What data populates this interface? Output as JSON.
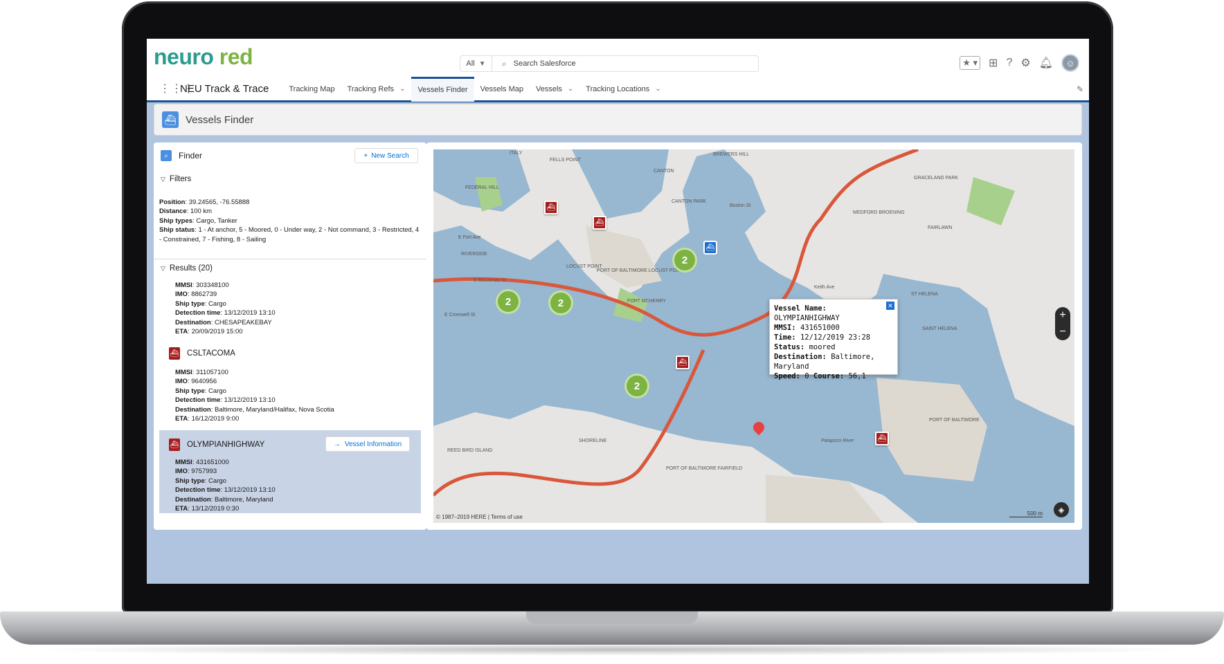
{
  "header": {
    "logo_part1": "neuro",
    "logo_part2": "red",
    "search_scope": "All",
    "search_placeholder": "Search Salesforce"
  },
  "nav": {
    "app_name": "NEU Track & Trace",
    "tabs": [
      {
        "label": "Tracking Map"
      },
      {
        "label": "Tracking Refs"
      },
      {
        "label": "Vessels Finder"
      },
      {
        "label": "Vessels Map"
      },
      {
        "label": "Vessels"
      },
      {
        "label": "Tracking Locations"
      }
    ]
  },
  "page": {
    "title": "Vessels Finder"
  },
  "finder": {
    "title": "Finder",
    "new_search_label": "New Search",
    "filters_title": "Filters",
    "filters": {
      "position_label": "Position",
      "position_value": ": 39.24565, -76.55888",
      "distance_label": "Distance",
      "distance_value": ": 100 km",
      "ship_types_label": "Ship types",
      "ship_types_value": ": Cargo, Tanker",
      "ship_status_label": "Ship status",
      "ship_status_value": ": 1 - At anchor, 5 - Moored, 0 - Under way, 2 - Not command, 3 - Restricted, 4 - Constrained, 7 - Fishing, 8 - Sailing"
    },
    "results_title": "Results (20)",
    "labels": {
      "mmsi": "MMSI",
      "imo": "IMO",
      "ship_type": "Ship type",
      "detection_time": "Detection time",
      "destination": "Destination",
      "eta": "ETA"
    },
    "results": [
      {
        "name": "",
        "mmsi": ": 303348100",
        "imo": ": 8862739",
        "ship_type": ": Cargo",
        "detection_time": ": 13/12/2019 13:10",
        "destination": ": CHESAPEAKEBAY",
        "eta": ": 20/09/2019 15:00"
      },
      {
        "name": "CSLTACOMA",
        "mmsi": ": 311057100",
        "imo": ": 9640956",
        "ship_type": ": Cargo",
        "detection_time": ": 13/12/2019 13:10",
        "destination": ": Baltimore, Maryland/Halifax, Nova Scotia",
        "eta": ": 16/12/2019 9:00"
      },
      {
        "name": "OLYMPIANHIGHWAY",
        "mmsi": ": 431651000",
        "imo": ": 9757993",
        "ship_type": ": Cargo",
        "detection_time": ": 13/12/2019 13:10",
        "destination": ": Baltimore, Maryland",
        "eta": ": 13/12/2019 0:30"
      }
    ],
    "vessel_info_label": "Vessel Information"
  },
  "map": {
    "clusters": [
      "2",
      "2",
      "2",
      "2"
    ],
    "popup": {
      "name_label": "Vessel Name:",
      "name_value": "OLYMPIANHIGHWAY",
      "mmsi_label": "MMSI:",
      "mmsi_value": "431651000",
      "time_label": "Time:",
      "time_value": "12/12/2019 23:28",
      "status_label": "Status:",
      "status_value": "moored",
      "destination_label": "Destination:",
      "destination_value": "Baltimore, Maryland",
      "speed_label": "Speed:",
      "speed_value": "0",
      "course_label": "Course:",
      "course_value": "56,1"
    },
    "labels": {
      "italy": "ITALY",
      "fells_point": "FELLS POINT",
      "canton": "CANTON",
      "brewers_hill": "BREWERS HILL",
      "federal_hill": "FEDERAL HILL",
      "canton_park": "CANTON PARK",
      "locust_point": "LOCUST POINT",
      "port_baltimore": "Port of Baltimore Locust Point",
      "fort_mchenry": "FORT MCHENRY",
      "riverside": "RIVERSIDE",
      "graceland": "GRACELAND PARK",
      "medford": "MEDFORD BROENING",
      "fairlawn": "FAIRLAWN",
      "shoreline": "SHORELINE",
      "patapsco": "Patapsco River",
      "port_dundalk": "Port of Baltimore",
      "st_helena": "ST HELENA",
      "saint_helena": "SAINT HELENA",
      "reedbird": "REED BIRD ISLAND",
      "port_fairfield": "Port of Baltimore Fairfield",
      "e_fort_ave": "E Fort Ave",
      "e_mccomas": "E McComas St",
      "e_cromwell": "E Cromwell St",
      "boston_st": "Boston St",
      "keith_ave": "Keith Ave"
    },
    "copyright": "© 1987–2019 HERE | Terms of use",
    "scale_label": "500 m",
    "zoom_in": "+",
    "zoom_out": "−"
  },
  "colors": {
    "brand_teal": "#2a9d8f",
    "brand_green": "#7cb342",
    "nav_active": "#1b5297",
    "vessel_red": "#a61b1b",
    "water": "#98b7d0",
    "route": "#d9573a"
  }
}
